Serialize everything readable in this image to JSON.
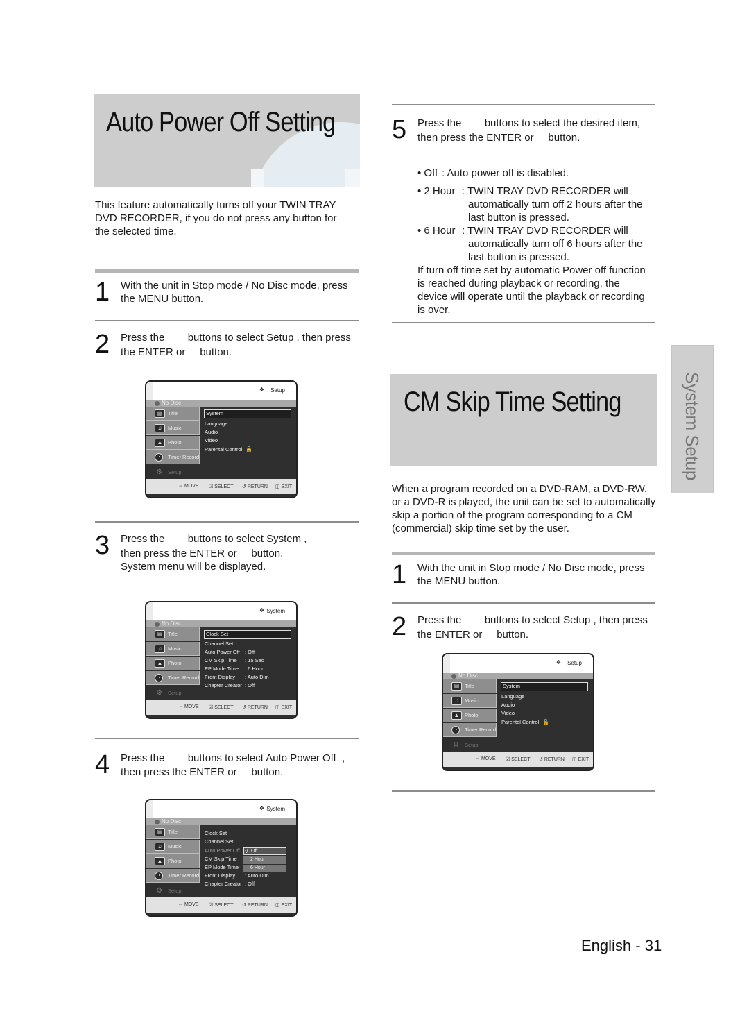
{
  "left": {
    "banner_title": "Auto Power Off Setting",
    "intro": "This feature automatically turns off your TWIN TRAY DVD RECORDER, if you do not press any button for the selected time.",
    "steps": [
      {
        "num": "1",
        "line1": "With the unit in Stop mode / No Disc mode, press",
        "line2": "the MENU button."
      },
      {
        "num": "2",
        "line1": "Press the        buttons to select Setup , then press",
        "line2": "the ENTER or     button."
      },
      {
        "num": "3",
        "line1": "Press the        buttons to select System ,",
        "line2": "then press the ENTER or     button.",
        "line3": "System menu will be displayed."
      },
      {
        "num": "4",
        "line1": "Press the        buttons to select Auto Power Off  ,",
        "line2": "then press the ENTER or     button."
      }
    ]
  },
  "right": {
    "step5": {
      "num": "5",
      "line1": "Press the        buttons to select the desired item,",
      "line2": "then press the ENTER or     button."
    },
    "options": [
      {
        "label": "• Off",
        "desc": ": Auto power off is disabled."
      },
      {
        "label": "• 2 Hour",
        "desc": ": TWIN TRAY DVD RECORDER will",
        "desc2": "automatically turn off 2 hours after the",
        "desc3": "last button is pressed."
      },
      {
        "label": "• 6 Hour",
        "desc": ": TWIN TRAY DVD RECORDER will",
        "desc2": "automatically turn off 6 hours after the",
        "desc3": "last button is pressed."
      }
    ],
    "note": [
      "If turn off time set by automatic Power off function",
      "is reached during playback or recording, the",
      "device will operate until the playback or recording",
      "is over."
    ],
    "banner_title": "CM Skip Time Setting",
    "intro": [
      "When a program recorded on a DVD-RAM, a DVD-RW,",
      "or a DVD-R is played, the unit can be set to automatically",
      "skip a portion of the program corresponding to a CM",
      "(commercial) skip time set by the user."
    ],
    "steps": [
      {
        "num": "1",
        "line1": "With the unit in Stop mode / No Disc mode, press",
        "line2": "the MENU button."
      },
      {
        "num": "2",
        "line1": "Press the        buttons to select Setup , then press",
        "line2": "the ENTER or     button."
      }
    ]
  },
  "osd_common": {
    "disc_status": "No Disc",
    "side_items": [
      "Title",
      "Music",
      "Photo",
      "Timer Record"
    ],
    "side_icons": [
      "film-icon",
      "music-note-icon",
      "photo-icon",
      "timer-record-icon"
    ],
    "setup_label": "Setup",
    "footer": {
      "move": "MOVE",
      "select": "SELECT",
      "return": "RETURN",
      "exit": "EXIT"
    }
  },
  "osd_setup": {
    "header": "Setup",
    "items": [
      "System",
      "Language",
      "Audio",
      "Video",
      "Parental Control"
    ],
    "selected": "System"
  },
  "osd_system": {
    "header": "System",
    "items": [
      {
        "label": "Clock Set",
        "value": ""
      },
      {
        "label": "Channel Set",
        "value": ""
      },
      {
        "label": "Auto Power Off",
        "value": ": Off"
      },
      {
        "label": "CM Skip Time",
        "value": ": 15 Sec"
      },
      {
        "label": "EP Mode Time",
        "value": ": 6 Hour"
      },
      {
        "label": "Front Display",
        "value": ": Auto Dim"
      },
      {
        "label": "Chapter Creator",
        "value": ": Off"
      }
    ],
    "selected": "Clock Set"
  },
  "osd_autopower": {
    "header": "System",
    "items": [
      {
        "label": "Clock Set",
        "value": ""
      },
      {
        "label": "Channel Set",
        "value": ""
      },
      {
        "label": "Auto Power Off",
        "value": ":"
      },
      {
        "label": "CM Skip Time",
        "value": ":"
      },
      {
        "label": "EP Mode Time",
        "value": ":"
      },
      {
        "label": "Front Display",
        "value": ": Auto Dim"
      },
      {
        "label": "Chapter Creator",
        "value": ": Off"
      }
    ],
    "popup": [
      "Off",
      "2 Hour",
      "6 Hour"
    ],
    "popup_selected": "Off",
    "check": "√"
  },
  "side_tab": "System Setup",
  "footer": "English - 31"
}
